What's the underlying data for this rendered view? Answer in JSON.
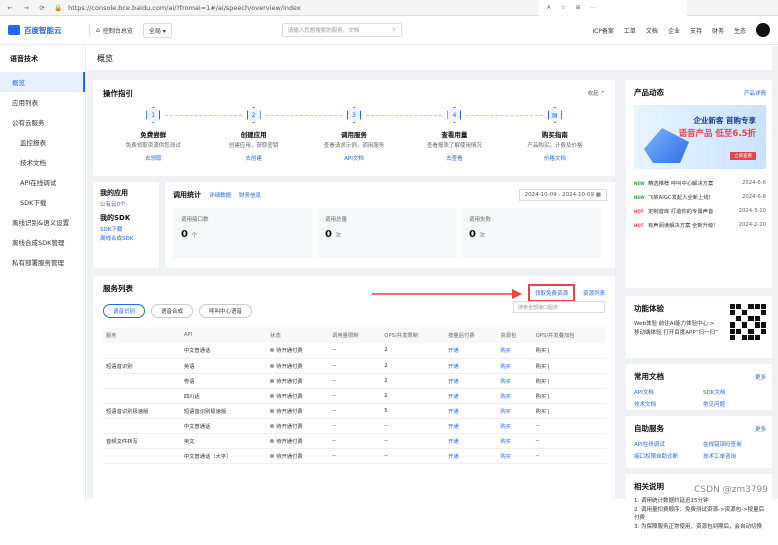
{
  "browser": {
    "url": "https://console.bce.baidu.com/ai/?fromai=1#/ai/speech/overview/index",
    "nav": [
      "←",
      "→",
      "⟳"
    ],
    "right_icons": [
      "A",
      "☆",
      "⊞",
      "⋯"
    ]
  },
  "topbar": {
    "logo": "百度智能云",
    "console": "控制台总览",
    "region": "全局",
    "search_placeholder": "请输入您想搜索的服务、文档",
    "nav": [
      "ICP备案",
      "工单",
      "文档",
      "企业",
      "支持",
      "财务",
      "生态"
    ]
  },
  "sidebar": {
    "title": "语音技术",
    "items": [
      {
        "label": "概览",
        "active": true
      },
      {
        "label": "应用列表"
      },
      {
        "label": "公有云服务"
      },
      {
        "label": "监控报表",
        "sub": true
      },
      {
        "label": "技术文档",
        "sub": true
      },
      {
        "label": "API在线调试",
        "sub": true
      },
      {
        "label": "SDK下载",
        "sub": true
      },
      {
        "label": "离线识别&语义设置"
      },
      {
        "label": "离线合成SDK管理"
      },
      {
        "label": "私有部署服务管理"
      }
    ]
  },
  "page_title": "概览",
  "guide": {
    "title": "操作指引",
    "collapse": "收起",
    "steps": [
      {
        "num": "1",
        "name": "免费尝鲜",
        "desc": "免费领取资源供您测试",
        "link": "去领取"
      },
      {
        "num": "2",
        "name": "创建应用",
        "desc": "创建应用，获取密钥",
        "link": "去创建"
      },
      {
        "num": "3",
        "name": "调用服务",
        "desc": "查看请求示例，调用服务",
        "link": "API文档"
      },
      {
        "num": "4",
        "name": "查看用量",
        "desc": "查看报表了解使用情况",
        "link": "去查看"
      },
      {
        "num": "",
        "name": "购买指南",
        "desc": "产品购买，计费及价格",
        "link": "价格文档"
      }
    ]
  },
  "myapp": {
    "title": "我的应用",
    "apps_link": "公有云0个",
    "sdk_title": "我的SDK",
    "sdk_links": [
      "SDK下载",
      "离线合成SDK"
    ]
  },
  "stats": {
    "title": "调用统计",
    "links": [
      "详细数据",
      "财务信息"
    ],
    "date_range": "2024-10-09 - 2024-10-09",
    "boxes": [
      {
        "label": "调用接口数",
        "value": "0",
        "unit": "个"
      },
      {
        "label": "调用总量",
        "value": "0",
        "unit": "次"
      },
      {
        "label": "调用失败",
        "value": "0",
        "unit": "次"
      }
    ]
  },
  "services": {
    "title": "服务列表",
    "free_link": "领取免费资源",
    "buy_link": "资源列表",
    "tabs": [
      "语音识别",
      "语音合成",
      "呼叫中心语音"
    ],
    "search_placeholder": "搜索全部接口服务",
    "columns": [
      "服务",
      "API",
      "状态",
      "调用量限制",
      "QPS/并发限制",
      "按量后付费",
      "资源包",
      "QPS/并发叠加包"
    ],
    "rows": [
      {
        "service": "",
        "api": "中文普通话",
        "status": "待开通付费",
        "limit": "--",
        "qps": "2",
        "pay": "开通",
        "pack": "购买",
        "add": "购买 |"
      },
      {
        "service": "短语音识别",
        "api": "英语",
        "status": "待开通付费",
        "limit": "--",
        "qps": "2",
        "pay": "开通",
        "pack": "购买",
        "add": "购买 |"
      },
      {
        "service": "",
        "api": "粤语",
        "status": "待开通付费",
        "limit": "--",
        "qps": "2",
        "pay": "开通",
        "pack": "购买",
        "add": "购买 |"
      },
      {
        "service": "",
        "api": "四川话",
        "status": "待开通付费",
        "limit": "--",
        "qps": "2",
        "pay": "开通",
        "pack": "购买",
        "add": "购买 |"
      },
      {
        "service": "短语音识别极速版",
        "api": "短语音识别极速版",
        "status": "待开通付费",
        "limit": "--",
        "qps": "5",
        "pay": "开通",
        "pack": "购买",
        "add": "购买 |"
      },
      {
        "service": "",
        "api": "中文普通话",
        "status": "待开通付费",
        "limit": "--",
        "qps": "--",
        "pay": "开通",
        "pack": "购买",
        "add": "--"
      },
      {
        "service": "音频文件转写",
        "api": "英文",
        "status": "待开通付费",
        "limit": "--",
        "qps": "--",
        "pay": "开通",
        "pack": "购买",
        "add": "--"
      },
      {
        "service": "",
        "api": "中文普通话（大字）",
        "status": "待开通付费",
        "limit": "--",
        "qps": "--",
        "pay": "开通",
        "pack": "购买",
        "add": "--"
      }
    ]
  },
  "dynamics": {
    "title": "产品动态",
    "more": "产品详情",
    "banner": {
      "line1": "企业新客 首购专享",
      "line2": "语音产品 低至6.5折",
      "btn": "立即查看"
    },
    "news": [
      {
        "tag": "NEW",
        "text": "精选推荐 呼叫中心解决方案",
        "date": "2024-6-6"
      },
      {
        "tag": "NEW",
        "text": "飞桨AIGC发起人全新上线!",
        "date": "2024-6-6"
      },
      {
        "tag": "HOT",
        "text": "定制音库 打造你的专属声音",
        "date": "2024-3-10"
      },
      {
        "tag": "HOT",
        "text": "有声阅读解决方案 全新升级!",
        "date": "2024-2-20"
      }
    ]
  },
  "experience": {
    "title": "功能体验",
    "lines": [
      "Web体验 前往AI能力体验中心 >",
      "移动端体验 打开百度APP“扫一扫”"
    ]
  },
  "docs": {
    "title": "常用文档",
    "more": "更多",
    "links": [
      "API文档",
      "SDK文档",
      "技术文档",
      "常见问题"
    ]
  },
  "self": {
    "title": "自助服务",
    "more": "更多",
    "links": [
      "API在线调试",
      "在线错误码查询",
      "接口权限自助诊断",
      "技术工单咨询"
    ]
  },
  "notes": {
    "title": "相关说明",
    "lines": [
      "1. 调用统计数据约延迟15分钟",
      "2. 调用量扣费顺序：免费测试资源->资源包->按量后付费",
      "3. 为保障服务正常使用，资源包到期后，会自动切换"
    ]
  },
  "watermark": "CSDN @zm3799",
  "colors": {
    "accent": "#2468f2",
    "highlight": "#e64545"
  }
}
